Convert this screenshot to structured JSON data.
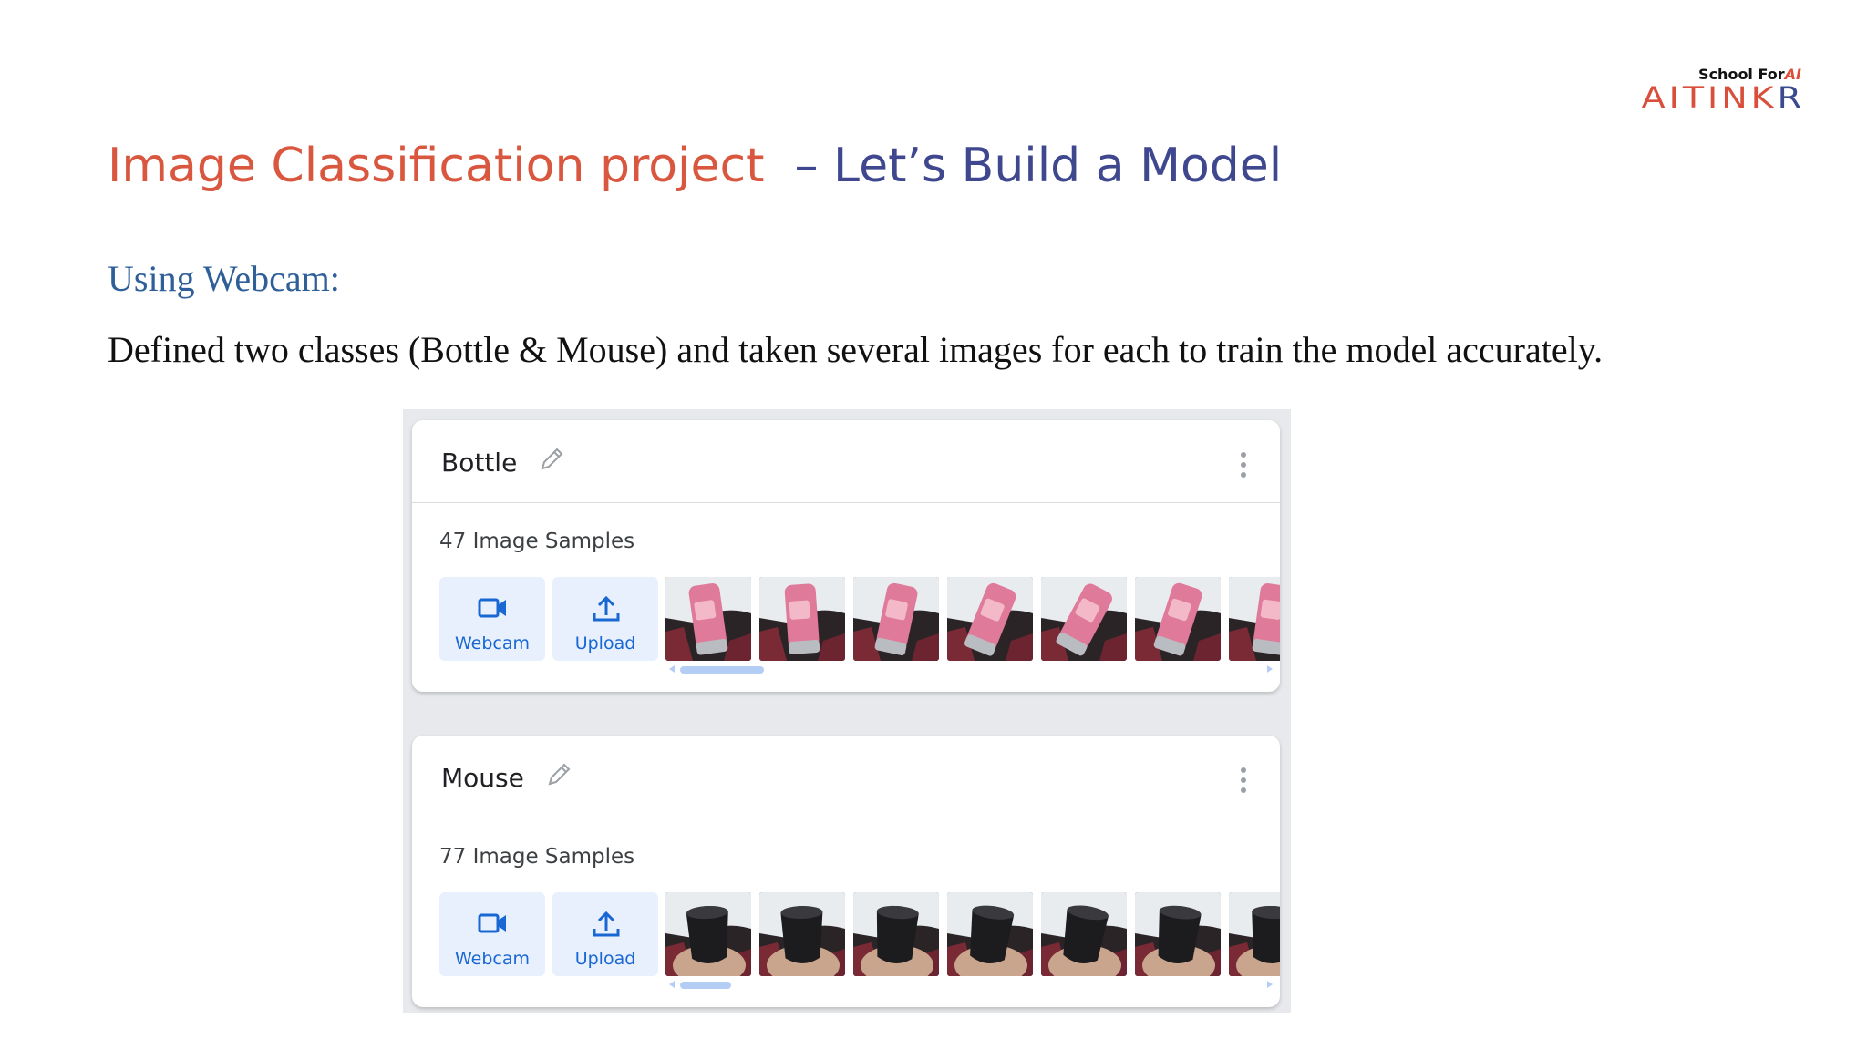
{
  "logo": {
    "tagline_prefix": "School For",
    "tagline_ai": "AI",
    "brand_red": "AITINK",
    "brand_blue": "R"
  },
  "title": {
    "part1": "Image Classification project",
    "part2": "– Let’s Build a Model"
  },
  "subtitle": "Using Webcam:",
  "body_text": "Defined two classes (Bottle & Mouse) and taken several images for each to train the model accurately.",
  "classes": [
    {
      "name": "Bottle",
      "samples_label": "47 Image Samples",
      "webcam_label": "Webcam",
      "upload_label": "Upload",
      "thumbnail_count": 7,
      "thumbnail_subject": "pink-bottle"
    },
    {
      "name": "Mouse",
      "samples_label": "77 Image Samples",
      "webcam_label": "Webcam",
      "upload_label": "Upload",
      "thumbnail_count": 7,
      "thumbnail_subject": "black-mouse"
    }
  ],
  "colors": {
    "title_red": "#d9573f",
    "title_blue": "#3f478f",
    "subtitle_blue": "#2e5f99",
    "button_bg": "#e8f0fe",
    "button_text": "#1967d2"
  }
}
